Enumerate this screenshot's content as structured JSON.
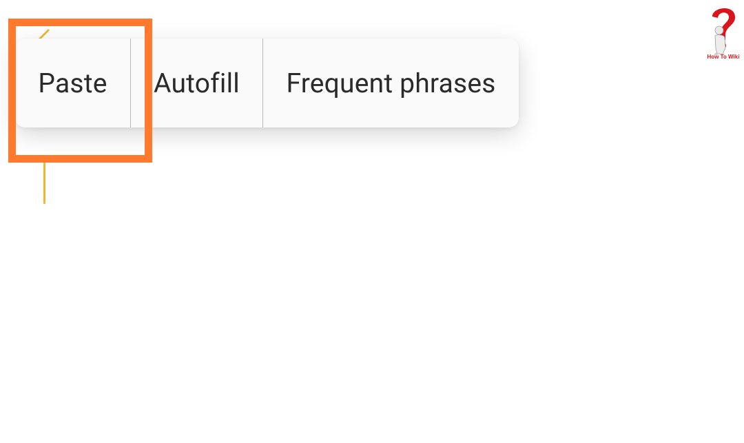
{
  "context_menu": {
    "items": [
      {
        "label": "Paste"
      },
      {
        "label": "Autofill"
      },
      {
        "label": "Frequent phrases"
      }
    ]
  },
  "colors": {
    "highlight": "#ff7a2f",
    "cursor": "#f2b630",
    "logo_red": "#d8151c"
  },
  "logo": {
    "icon": "question-mark-figure-icon",
    "text": "How To Wiki"
  }
}
